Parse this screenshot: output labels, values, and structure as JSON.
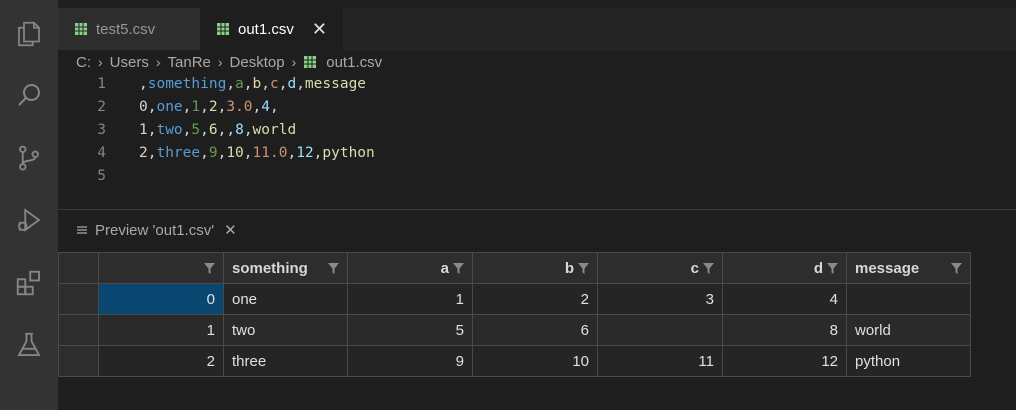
{
  "tabs": [
    {
      "label": "test5.csv",
      "active": false
    },
    {
      "label": "out1.csv",
      "active": true
    }
  ],
  "tab_close_glyph": "✕",
  "breadcrumb": [
    "C:",
    "Users",
    "TanRe",
    "Desktop",
    "out1.csv"
  ],
  "editor": {
    "line_numbers": [
      "1",
      "2",
      "3",
      "4",
      "5"
    ],
    "lines": [
      [
        [
          ",",
          "w"
        ],
        [
          "something",
          "b"
        ],
        [
          ",",
          "w"
        ],
        [
          "a",
          "g"
        ],
        [
          ",",
          "w"
        ],
        [
          "b",
          "y"
        ],
        [
          ",",
          "w"
        ],
        [
          "c",
          "o"
        ],
        [
          ",",
          "w"
        ],
        [
          "d",
          "l"
        ],
        [
          ",",
          "w"
        ],
        [
          "message",
          "y"
        ]
      ],
      [
        [
          "0",
          "w"
        ],
        [
          ",",
          "w"
        ],
        [
          "one",
          "b"
        ],
        [
          ",",
          "w"
        ],
        [
          "1",
          "g"
        ],
        [
          ",",
          "w"
        ],
        [
          "2",
          "y"
        ],
        [
          ",",
          "w"
        ],
        [
          "3.0",
          "o"
        ],
        [
          ",",
          "w"
        ],
        [
          "4",
          "l"
        ],
        [
          ",",
          "w"
        ]
      ],
      [
        [
          "1",
          "w"
        ],
        [
          ",",
          "w"
        ],
        [
          "two",
          "b"
        ],
        [
          ",",
          "w"
        ],
        [
          "5",
          "g"
        ],
        [
          ",",
          "w"
        ],
        [
          "6",
          "y"
        ],
        [
          ",,",
          "w"
        ],
        [
          "8",
          "l"
        ],
        [
          ",",
          "w"
        ],
        [
          "world",
          "y"
        ]
      ],
      [
        [
          "2",
          "w"
        ],
        [
          ",",
          "w"
        ],
        [
          "three",
          "b"
        ],
        [
          ",",
          "w"
        ],
        [
          "9",
          "g"
        ],
        [
          ",",
          "w"
        ],
        [
          "10",
          "y"
        ],
        [
          ",",
          "w"
        ],
        [
          "11.0",
          "o"
        ],
        [
          ",",
          "w"
        ],
        [
          "12",
          "l"
        ],
        [
          ",",
          "w"
        ],
        [
          "python",
          "y"
        ]
      ],
      []
    ]
  },
  "preview": {
    "tab_label": "Preview 'out1.csv'",
    "close_glyph": "✕"
  },
  "grid": {
    "columns": [
      "",
      "something",
      "a",
      "b",
      "c",
      "d",
      "message"
    ],
    "rows": [
      [
        "0",
        "one",
        "1",
        "2",
        "3",
        "4",
        ""
      ],
      [
        "1",
        "two",
        "5",
        "6",
        "",
        "8",
        "world"
      ],
      [
        "2",
        "three",
        "9",
        "10",
        "11",
        "12",
        "python"
      ]
    ]
  },
  "colors": {
    "selection": "#094771",
    "activity_bar": "#333333",
    "editor_bg": "#1e1e1e",
    "csv_icon": "#89d185"
  }
}
